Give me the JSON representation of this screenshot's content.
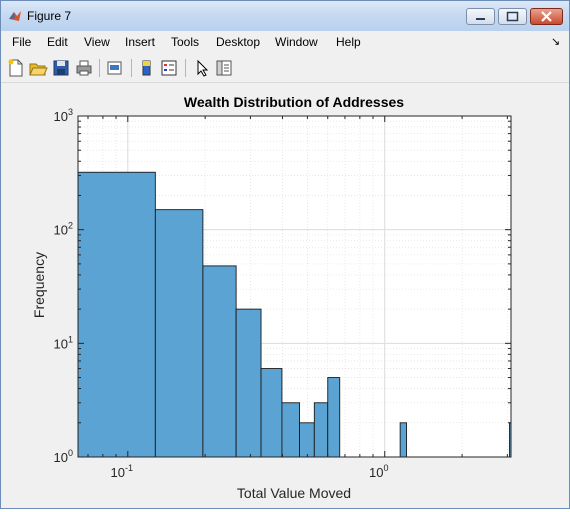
{
  "window": {
    "title": "Figure 7"
  },
  "menu": [
    "File",
    "Edit",
    "View",
    "Insert",
    "Tools",
    "Desktop",
    "Window",
    "Help"
  ],
  "toolbar_icons": [
    "new-figure-icon",
    "open-file-icon",
    "save-icon",
    "print-icon",
    "link-plot-icon",
    "colorbar-icon",
    "legend-icon",
    "edit-plot-arrow-icon",
    "property-inspector-icon"
  ],
  "chart_data": {
    "type": "bar",
    "title": "Wealth Distribution of Addresses",
    "xlabel": "Total Value Moved",
    "ylabel": "Frequency",
    "xscale": "log",
    "yscale": "log",
    "xlim": [
      0.064,
      3.1
    ],
    "ylim": [
      1,
      1000
    ],
    "grid": true,
    "minor_grid": true,
    "bar_color": "#5ba3d3",
    "x_ticks": [
      {
        "base": "10",
        "exp": "-1"
      },
      {
        "base": "10",
        "exp": "0"
      }
    ],
    "y_ticks": [
      {
        "base": "10",
        "exp": "0"
      },
      {
        "base": "10",
        "exp": "1"
      },
      {
        "base": "10",
        "exp": "2"
      },
      {
        "base": "10",
        "exp": "3"
      }
    ],
    "bins": [
      {
        "x0": 0.064,
        "x1": 0.128,
        "value": 320
      },
      {
        "x0": 0.128,
        "x1": 0.196,
        "value": 150
      },
      {
        "x0": 0.196,
        "x1": 0.264,
        "value": 48
      },
      {
        "x0": 0.264,
        "x1": 0.33,
        "value": 20
      },
      {
        "x0": 0.33,
        "x1": 0.398,
        "value": 6
      },
      {
        "x0": 0.398,
        "x1": 0.466,
        "value": 3
      },
      {
        "x0": 0.466,
        "x1": 0.532,
        "value": 2
      },
      {
        "x0": 0.532,
        "x1": 0.6,
        "value": 3
      },
      {
        "x0": 0.6,
        "x1": 0.668,
        "value": 5
      },
      {
        "x0": 1.148,
        "x1": 1.216,
        "value": 2
      },
      {
        "x0": 3.06,
        "x1": 3.1,
        "value": 2
      }
    ]
  }
}
